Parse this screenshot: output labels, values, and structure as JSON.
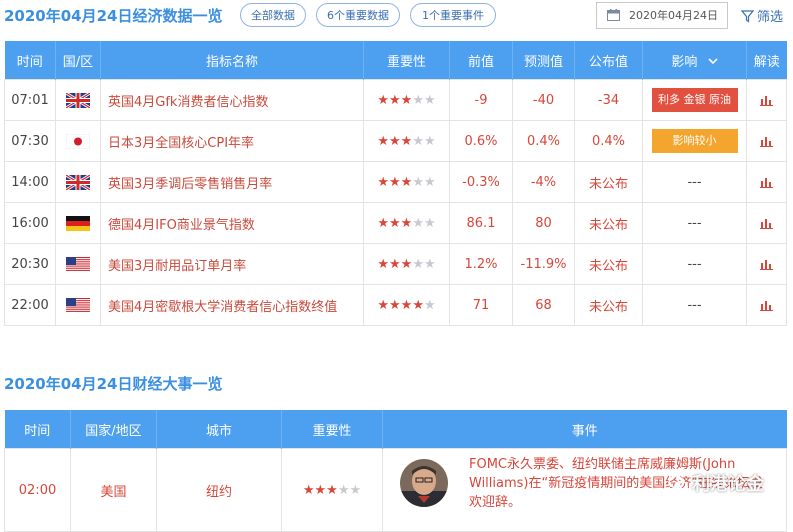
{
  "header": {
    "title": "2020年04月24日经济数据一览",
    "filters": [
      "全部数据",
      "6个重要数据",
      "1个重要事件"
    ],
    "date": "2020年04月24日",
    "filter_label": "筛选"
  },
  "econ_table": {
    "columns": [
      "时间",
      "国/区",
      "指标名称",
      "重要性",
      "前值",
      "预测值",
      "公布值",
      "影响",
      "解读"
    ],
    "rows": [
      {
        "time": "07:01",
        "flag": "uk-flag",
        "name": "英国4月Gfk消费者信心指数",
        "stars": 3,
        "prev": "-9",
        "forecast": "-40",
        "actual": "-34",
        "impact": "利多 金银 原油",
        "impact_color": "#e25040"
      },
      {
        "time": "07:30",
        "flag": "japan-flag",
        "name": "日本3月全国核心CPI年率",
        "stars": 3,
        "prev": "0.6%",
        "forecast": "0.4%",
        "actual": "0.4%",
        "impact": "影响较小",
        "impact_color": "#f3a52d"
      },
      {
        "time": "14:00",
        "flag": "uk-flag",
        "name": "英国3月季调后零售销售月率",
        "stars": 3,
        "prev": "-0.3%",
        "forecast": "-4%",
        "actual": "未公布",
        "impact": "---",
        "impact_color": ""
      },
      {
        "time": "16:00",
        "flag": "germany-flag",
        "name": "德国4月IFO商业景气指数",
        "stars": 3,
        "prev": "86.1",
        "forecast": "80",
        "actual": "未公布",
        "impact": "---",
        "impact_color": ""
      },
      {
        "time": "20:30",
        "flag": "us-flag",
        "name": "美国3月耐用品订单月率",
        "stars": 3,
        "prev": "1.2%",
        "forecast": "-11.9%",
        "actual": "未公布",
        "impact": "---",
        "impact_color": ""
      },
      {
        "time": "22:00",
        "flag": "us-flag",
        "name": "美国4月密歇根大学消费者信心指数终值",
        "stars": 4,
        "prev": "71",
        "forecast": "68",
        "actual": "未公布",
        "impact": "---",
        "impact_color": ""
      }
    ]
  },
  "events_section": {
    "title": "2020年04月24日财经大事一览",
    "columns": [
      "时间",
      "国家/地区",
      "城市",
      "重要性",
      "事件"
    ],
    "rows": [
      {
        "time": "02:00",
        "country": "美国",
        "city": "纽约",
        "stars": 3,
        "event": "FOMC永久票委、纽约联储主席威廉姆斯(John Williams)在“新冠疫情期间的美国经济”在线论坛发欢迎辞。"
      }
    ]
  },
  "watermark": "利港论金",
  "colors": {
    "header_blue": "#4d9ff0",
    "title_blue": "#3b8fe0",
    "accent_red": "#d9463a",
    "impact_orange": "#f3a52d"
  }
}
